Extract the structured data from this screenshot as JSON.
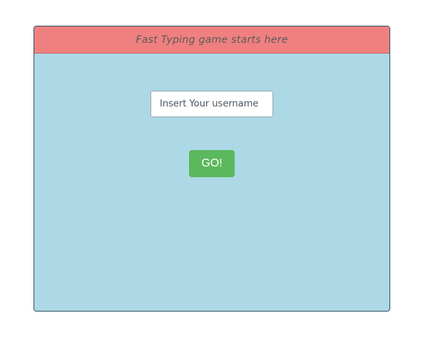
{
  "panel": {
    "header_text": "Fast Typing game starts here"
  },
  "form": {
    "username_placeholder": "Insert Your username",
    "username_value": "",
    "go_label": "GO!"
  },
  "colors": {
    "header_bg": "#f08080",
    "panel_bg": "#add8e6",
    "go_button_bg": "#5cb85c"
  }
}
